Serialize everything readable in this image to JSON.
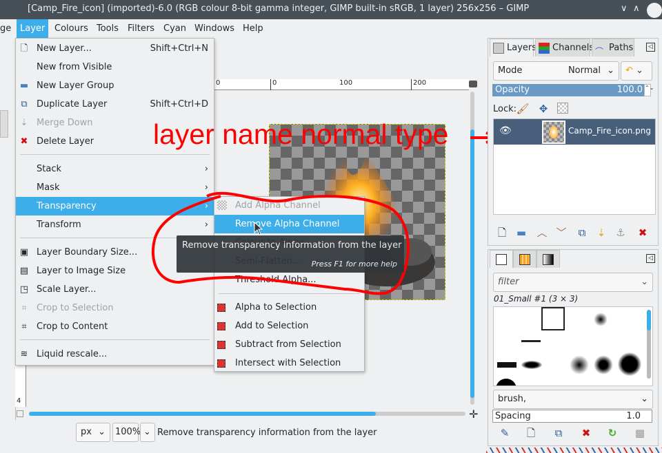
{
  "window": {
    "title": "[Camp_Fire_icon] (imported)-6.0 (RGB colour 8-bit gamma integer, GIMP built-in sRGB, 1 layer) 256x256 – GIMP",
    "controls": [
      "∨",
      "∧"
    ]
  },
  "menubar": [
    "ge",
    "Layer",
    "Colours",
    "Tools",
    "Filters",
    "Cyan",
    "Windows",
    "Help"
  ],
  "layer_menu": {
    "items": [
      {
        "label": "New Layer...",
        "shortcut": "Shift+Ctrl+N",
        "icon": "new-layer-icon"
      },
      {
        "label": "New from Visible",
        "shortcut": "",
        "icon": ""
      },
      {
        "label": "New Layer Group",
        "shortcut": "",
        "icon": "layer-group-icon"
      },
      {
        "label": "Duplicate Layer",
        "shortcut": "Shift+Ctrl+D",
        "icon": "duplicate-icon"
      },
      {
        "label": "Merge Down",
        "shortcut": "",
        "icon": "merge-down-icon",
        "disabled": true
      },
      {
        "label": "Delete Layer",
        "shortcut": "",
        "icon": "delete-icon"
      },
      {
        "label": "Stack",
        "submenu": true
      },
      {
        "label": "Mask",
        "submenu": true
      },
      {
        "label": "Transparency",
        "submenu": true,
        "highlighted": true
      },
      {
        "label": "Transform",
        "submenu": true
      },
      {
        "label": "Layer Boundary Size...",
        "icon": "boundary-icon"
      },
      {
        "label": "Layer to Image Size",
        "icon": "to-image-icon"
      },
      {
        "label": "Scale Layer...",
        "icon": "scale-icon"
      },
      {
        "label": "Crop to Selection",
        "icon": "crop-icon",
        "disabled": true
      },
      {
        "label": "Crop to Content",
        "icon": "crop-icon"
      },
      {
        "label": "Liquid rescale...",
        "icon": "liquid-icon"
      }
    ]
  },
  "transparency_menu": {
    "items": [
      {
        "label": "Add Alpha Channel",
        "disabled": true
      },
      {
        "label": "Remove Alpha Channel",
        "highlighted": true
      },
      {
        "label": "Colour to Alpha..."
      },
      {
        "label": "Semi-Flatten..."
      },
      {
        "label": "Threshold Alpha..."
      },
      {
        "label": "Alpha to Selection"
      },
      {
        "label": "Add to Selection"
      },
      {
        "label": "Subtract from Selection"
      },
      {
        "label": "Intersect with Selection"
      }
    ]
  },
  "tooltip": {
    "text": "Remove transparency information from the layer",
    "help": "Press F1 for more help"
  },
  "ruler": {
    "labels": [
      "0",
      "0",
      "100",
      "200"
    ],
    "vlabel": "4"
  },
  "annotation": {
    "text": "layer name normal type",
    "color": "#ff0000"
  },
  "status": {
    "unit": "px",
    "zoom": "100%",
    "message": "Remove transparency information from the layer"
  },
  "layers_panel": {
    "tabs": [
      "Layers",
      "Channels",
      "Paths"
    ],
    "mode_label": "Mode",
    "mode_value": "Normal",
    "opacity_label": "Opacity",
    "opacity_value": "100.0",
    "lock_label": "Lock:",
    "layer_name": "Camp_Fire_icon.png"
  },
  "brushes_panel": {
    "filter_placeholder": "filter",
    "brush_name": "01_Small #1 (3 × 3)",
    "tag": "brush,",
    "spacing_label": "Spacing",
    "spacing_value": "1.0"
  },
  "colors": {
    "accent": "#3daee9",
    "selected_layer": "#475f7a"
  }
}
